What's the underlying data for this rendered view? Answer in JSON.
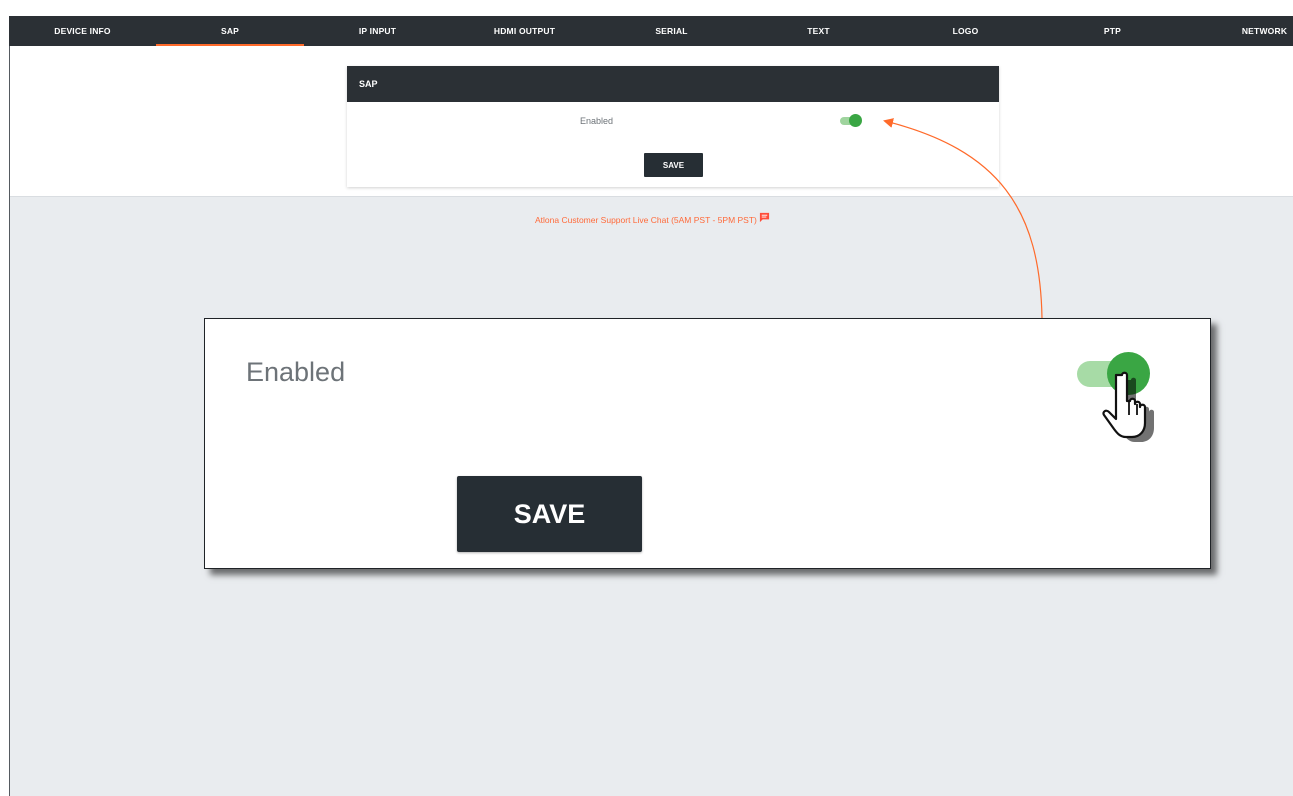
{
  "nav": {
    "tabs": [
      {
        "label": "DEVICE INFO"
      },
      {
        "label": "SAP"
      },
      {
        "label": "IP INPUT"
      },
      {
        "label": "HDMI OUTPUT"
      },
      {
        "label": "SERIAL"
      },
      {
        "label": "TEXT"
      },
      {
        "label": "LOGO"
      },
      {
        "label": "PTP"
      },
      {
        "label": "NETWORK"
      }
    ],
    "active_tab": "SAP"
  },
  "sap_card": {
    "title": "SAP",
    "enabled_label": "Enabled",
    "enabled": true,
    "save_label": "SAVE"
  },
  "support": {
    "text": "Atlona Customer Support Live Chat (5AM PST - 5PM PST)",
    "icon": "chat-bubble-icon"
  },
  "zoom_callout": {
    "enabled_label": "Enabled",
    "enabled": true,
    "save_label": "SAVE",
    "cursor_icon": "hand-pointer-icon"
  },
  "colors": {
    "nav_bg": "#2b3035",
    "accent": "#ff6a2a",
    "toggle_on": "#3aa644",
    "toggle_track": "#a7dba6",
    "button_bg": "#262e34",
    "gray_bg": "#e9ecef"
  }
}
